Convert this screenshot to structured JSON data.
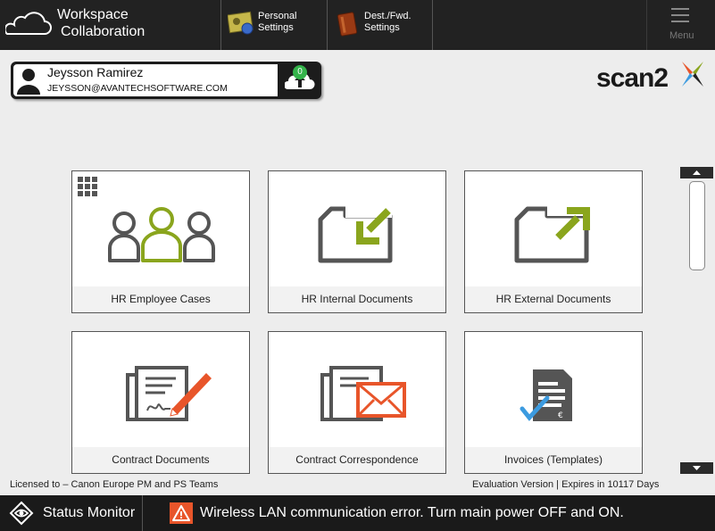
{
  "header": {
    "title_line1": "Workspace",
    "title_line2": "Collaboration",
    "personal_settings": [
      "Personal",
      "Settings"
    ],
    "dest_settings": [
      "Dest./Fwd.",
      "Settings"
    ],
    "menu_label": "Menu"
  },
  "user": {
    "name": "Jeysson Ramirez",
    "email": "JEYSSON@AVANTECHSOFTWARE.COM",
    "pending_count": "0"
  },
  "logo": {
    "text": "scan2"
  },
  "tiles": [
    {
      "label": "HR Employee Cases",
      "icon": "people-icon"
    },
    {
      "label": "HR Internal Documents",
      "icon": "folder-in-icon"
    },
    {
      "label": "HR External Documents",
      "icon": "folder-out-icon"
    },
    {
      "label": "Contract Documents",
      "icon": "contract-sign-icon"
    },
    {
      "label": "Contract Correspondence",
      "icon": "envelope-icon"
    },
    {
      "label": "Invoices (Templates)",
      "icon": "invoice-icon"
    }
  ],
  "footer": {
    "license": "Licensed to – Canon Europe PM and PS Teams",
    "evaluation": "Evaluation Version | Expires in 10117 Days"
  },
  "statusbar": {
    "monitor_label": "Status Monitor",
    "message": "Wireless LAN communication error. Turn main power OFF and ON."
  },
  "colors": {
    "accent_green": "#8aa51d",
    "accent_orange": "#e8552a",
    "check_blue": "#3c9be0",
    "status_ok": "#34b34a"
  }
}
